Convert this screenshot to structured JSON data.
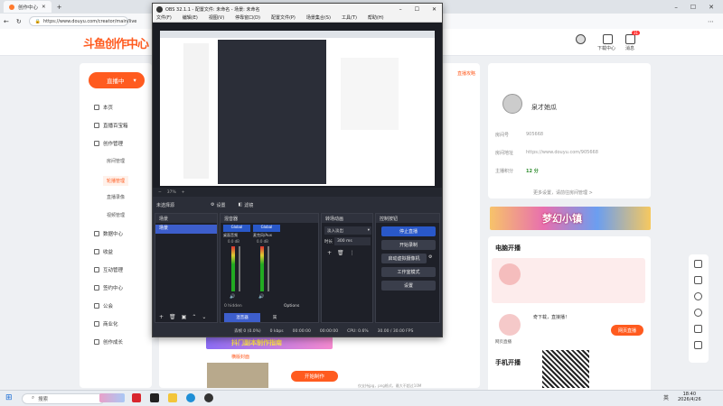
{
  "browser": {
    "tab_title": "创作中心",
    "url": "https://www.douyu.com/creator/main/live"
  },
  "page": {
    "logo_text": "斗鱼创作中心",
    "top_right": {
      "download_label": "下载中心",
      "messages_label": "消息",
      "message_badge": "31"
    },
    "sidebar": {
      "live_button": "直播中",
      "items": [
        {
          "label": "本页"
        },
        {
          "label": "直播百宝箱"
        },
        {
          "label": "创作管理"
        },
        {
          "label": "数据中心"
        },
        {
          "label": "收益"
        },
        {
          "label": "互动管理"
        },
        {
          "label": "签约中心"
        },
        {
          "label": "公会"
        },
        {
          "label": "商业化"
        },
        {
          "label": "创作成长"
        }
      ],
      "sub_items": [
        {
          "label": "房间管理"
        },
        {
          "label": "轮播管理"
        },
        {
          "label": "直播录像"
        },
        {
          "label": "视频管理"
        }
      ]
    },
    "profile": {
      "username": "泉才她瓜",
      "room_label": "房间号",
      "room_value": "905668",
      "room_link_label": "房间地址",
      "room_link_value": "https://www.douyu.com/905668",
      "points_label": "主播积分",
      "points_value": "12 分",
      "more_link": "更多设置，请前往房间管理 >",
      "banner_text": "梦幻小镇",
      "tip_link": "直播攻略"
    },
    "computer_live": {
      "title": "电脑开播",
      "web_live_title": "网页直播",
      "web_live_button": "网页直播",
      "web_live_text": "奇下载，直接播！"
    },
    "mobile_live": {
      "title": "手机开播"
    },
    "main_bottom": {
      "banner_text": "抖门副本制作指南",
      "cover_label": "横版封面",
      "start_button": "开始制作",
      "format_hint": "仅支持jpg，png格式，最大不超过10M"
    }
  },
  "obs": {
    "title": "OBS 32.1.1 - 配置文件: 未命名 - 场景: 未命名",
    "menu": [
      "文件(F)",
      "编辑(E)",
      "视图(V)",
      "停靠窗口(D)",
      "配置文件(P)",
      "场景集合(S)",
      "工具(T)",
      "帮助(H)"
    ],
    "preview_zoom": "37%",
    "source_bar": {
      "selected": "未选择源",
      "properties": "设置",
      "filters": "滤镜"
    },
    "scenes_title": "场景",
    "scene_item": "场景",
    "mixer_title": "混音器",
    "mixer": {
      "channels": [
        {
          "name": "桌面音频",
          "db": "0.0 dB",
          "tag": "Global"
        },
        {
          "name": "麦克风/Aux",
          "db": "0.0 dB",
          "tag": "Global"
        }
      ],
      "hidden": "0 hidden",
      "options": "Options",
      "tab_mixer": "混音器",
      "tab_other": "属"
    },
    "transitions_title": "转场动画",
    "transition_value": "淡入淡出",
    "duration_label": "时长",
    "duration_value": "300 ms",
    "controls_title": "控制按钮",
    "controls": [
      "停止直播",
      "开始录制",
      "启动虚拟摄像机",
      "工作室模式",
      "设置"
    ],
    "status": {
      "frames": "丢帧 0 (0.0%)",
      "kbps": "0 kbps",
      "time1": "00:00:00",
      "time2": "00:00:00",
      "cpu": "CPU: 0.6%",
      "fps": "30.00 / 30.00 FPS"
    }
  },
  "taskbar": {
    "search_placeholder": "搜索",
    "time": "18:40",
    "date": "2026/4/26",
    "ime": "英"
  }
}
